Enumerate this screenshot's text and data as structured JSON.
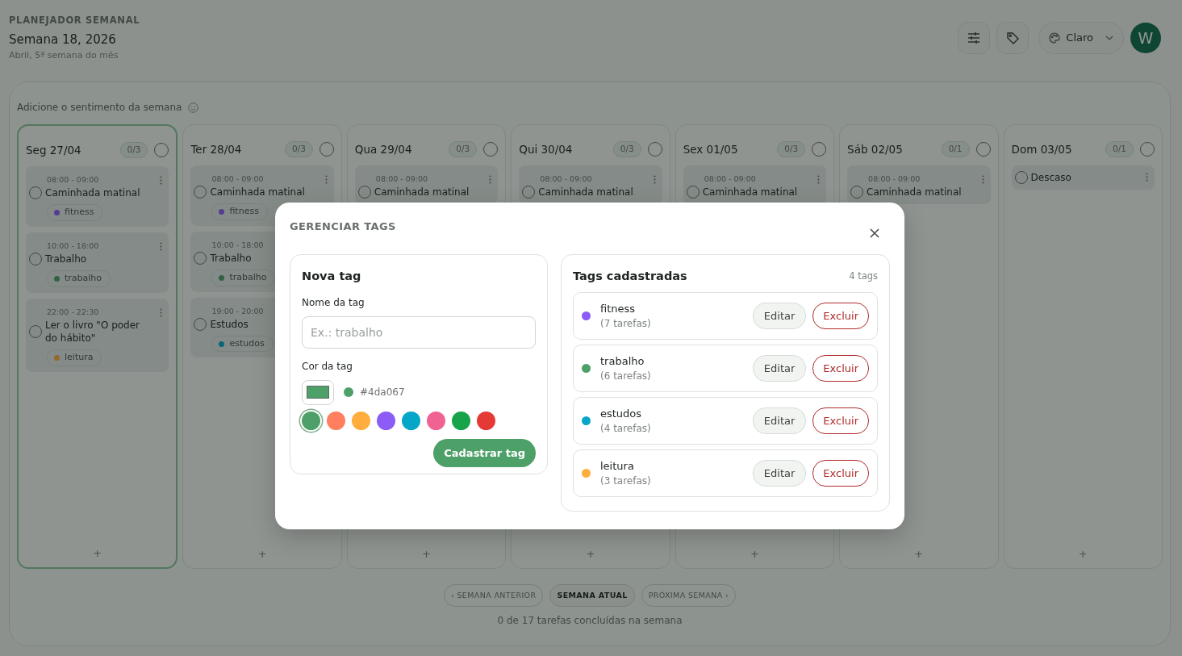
{
  "header": {
    "eyebrow": "PLANEJADOR SEMANAL",
    "title": "Semana 18, 2026",
    "subtitle": "Abril, 5ª semana do mês"
  },
  "toolbar": {
    "theme": "Claro",
    "avatar": "W"
  },
  "week": {
    "mood_prompt": "Adicione o sentimento da semana",
    "days": [
      {
        "label": "Seg 27/04",
        "count": "0/3",
        "today": true,
        "done": false,
        "tasks": [
          {
            "time": "08:00 - 09:00",
            "title": "Caminhada matinal",
            "done": false,
            "tag": {
              "label": "fitness",
              "color": "#533e90"
            }
          },
          {
            "time": "10:00 - 18:00",
            "title": "Trabalho",
            "done": false,
            "tag": {
              "label": "trabalho",
              "color": "#316342"
            }
          },
          {
            "time": "22:00 - 22:30",
            "title": "Ler o livro \"O poder do hábito\"",
            "done": false,
            "tag": {
              "label": "leitura",
              "color": "#936a2b"
            }
          }
        ],
        "add": "+"
      },
      {
        "label": "Ter 28/04",
        "count": "0/3",
        "today": false,
        "done": false,
        "tasks": [
          {
            "time": "08:00 - 09:00",
            "title": "Caminhada matinal",
            "done": false,
            "tag": {
              "label": "fitness",
              "color": "#533e90"
            }
          },
          {
            "time": "10:00 - 18:00",
            "title": "Trabalho",
            "done": false,
            "tag": {
              "label": "trabalho",
              "color": "#316342"
            }
          },
          {
            "time": "19:00 - 20:00",
            "title": "Estudos",
            "done": false,
            "tag": {
              "label": "estudos",
              "color": "#0a6777"
            }
          }
        ],
        "add": "+"
      },
      {
        "label": "Qua 29/04",
        "count": "0/3",
        "today": false,
        "done": false,
        "tasks": [
          {
            "time": "08:00 - 09:00",
            "title": "Caminhada matinal",
            "done": false
          }
        ],
        "add": "+"
      },
      {
        "label": "Qui 30/04",
        "count": "0/3",
        "today": false,
        "done": false,
        "tasks": [
          {
            "time": "08:00 - 09:00",
            "title": "Caminhada matinal",
            "done": false
          }
        ],
        "add": "+"
      },
      {
        "label": "Sex 01/05",
        "count": "0/3",
        "today": false,
        "done": false,
        "tasks": [
          {
            "time": "08:00 - 09:00",
            "title": "Caminhada matinal",
            "done": false
          }
        ],
        "add": "+"
      },
      {
        "label": "Sáb 02/05",
        "count": "0/1",
        "today": false,
        "done": false,
        "tasks": [
          {
            "time": "08:00 - 09:00",
            "title": "Caminhada matinal",
            "done": false
          }
        ],
        "add": "+"
      },
      {
        "label": "Dom 03/05",
        "count": "0/1",
        "today": false,
        "done": false,
        "tasks": [
          {
            "title": "Descaso",
            "done": false
          }
        ],
        "add": "+"
      }
    ]
  },
  "nav": [
    {
      "label": "‹ SEMANA ANTERIOR",
      "selected": false
    },
    {
      "label": "SEMANA ATUAL",
      "selected": true
    },
    {
      "label": "PRÓXIMA SEMANA ›",
      "selected": false
    }
  ],
  "summary": "0 de 17 tarefas concluídas na semana",
  "modal": {
    "title": "GERENCIAR TAGS",
    "new_tag": {
      "heading": "Nova tag",
      "name_label": "Nome da tag",
      "name_placeholder": "Ex.: trabalho",
      "color_label": "Cor da tag",
      "color": "#4da067",
      "color_hex": "#4da067",
      "swatches": [
        {
          "color": "#4da067",
          "selected": true
        },
        {
          "color": "#ff7f5e",
          "selected": false
        },
        {
          "color": "#ffad3d",
          "selected": false
        },
        {
          "color": "#8b5cf6",
          "selected": false
        },
        {
          "color": "#06a6c8",
          "selected": false
        },
        {
          "color": "#f06292",
          "selected": false
        },
        {
          "color": "#16a34a",
          "selected": false
        },
        {
          "color": "#e53935",
          "selected": false
        }
      ],
      "submit": "Cadastrar tag"
    },
    "tags": {
      "heading": "Tags cadastradas",
      "count": "4 tags",
      "items": [
        {
          "name": "fitness",
          "count": "(7 tarefas)",
          "color": "#8b5cf6",
          "edit": "Editar",
          "delete": "Excluir"
        },
        {
          "name": "trabalho",
          "count": "(6 tarefas)",
          "color": "#4da067",
          "edit": "Editar",
          "delete": "Excluir"
        },
        {
          "name": "estudos",
          "count": "(4 tarefas)",
          "color": "#06a6c8",
          "edit": "Editar",
          "delete": "Excluir"
        },
        {
          "name": "leitura",
          "count": "(3 tarefas)",
          "color": "#ffad3d",
          "edit": "Editar",
          "delete": "Excluir"
        }
      ]
    }
  }
}
